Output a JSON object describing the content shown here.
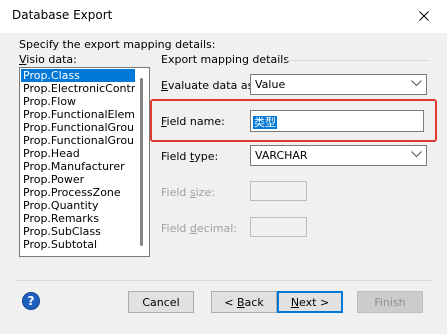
{
  "window": {
    "title": "Database Export"
  },
  "instructions": "Specify the export mapping details:",
  "visio_data": {
    "label": "Visio data:",
    "items": [
      "Prop.Class",
      "Prop.ElectronicControl",
      "Prop.Flow",
      "Prop.FunctionalElement",
      "Prop.FunctionalGroup",
      "Prop.FunctionalGroup",
      "Prop.Head",
      "Prop.Manufacturer",
      "Prop.Power",
      "Prop.ProcessZone",
      "Prop.Quantity",
      "Prop.Remarks",
      "Prop.SubClass",
      "Prop.Subtotal"
    ],
    "selected_index": 0
  },
  "mapping": {
    "group_title": "Export mapping details",
    "evaluate": {
      "label": "Evaluate data as:",
      "value": "Value"
    },
    "field_name": {
      "label": "Field name:",
      "value": "类型"
    },
    "field_type": {
      "label": "Field type:",
      "value": "VARCHAR"
    },
    "field_size": {
      "label": "Field size:"
    },
    "field_decimal": {
      "label": "Field decimal:"
    }
  },
  "buttons": {
    "help": "?",
    "cancel": "Cancel",
    "back": "< Back",
    "next": "Next >",
    "finish": "Finish"
  },
  "colors": {
    "selection": "#0078d7",
    "highlight_border": "#e03a2e",
    "default_button_border": "#0078d7"
  },
  "icons": {
    "close": "close-icon",
    "dropdown": "chevron-down-icon",
    "help": "help-icon"
  }
}
